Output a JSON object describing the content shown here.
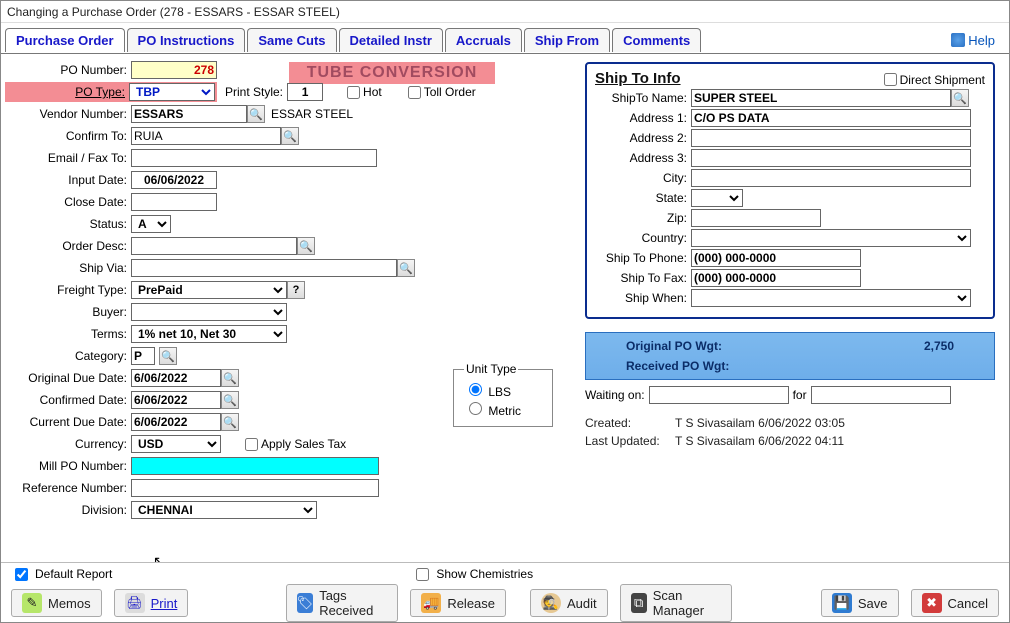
{
  "window": {
    "title": "Changing a Purchase Order  (278 - ESSARS -  ESSAR STEEL)"
  },
  "tabs": {
    "po": "Purchase Order",
    "instr": "PO Instructions",
    "same": "Same Cuts",
    "det": "Detailed Instr",
    "accr": "Accruals",
    "ship": "Ship From",
    "comm": "Comments"
  },
  "help": "Help",
  "watermark": "TUBE CONVERSION",
  "labels": {
    "po_number": "PO Number:",
    "po_type": "PO Type:",
    "print_style": "Print Style:",
    "hot": "Hot",
    "toll": "Toll Order",
    "vendor_number": "Vendor Number:",
    "confirm_to": "Confirm To:",
    "email_fax": "Email / Fax To:",
    "input_date": "Input Date:",
    "close_date": "Close Date:",
    "status": "Status:",
    "order_desc": "Order Desc:",
    "ship_via": "Ship Via:",
    "freight_type": "Freight Type:",
    "buyer": "Buyer:",
    "terms": "Terms:",
    "category": "Category:",
    "orig_due": "Original Due Date:",
    "conf_date": "Confirmed Date:",
    "curr_due": "Current Due Date:",
    "currency": "Currency:",
    "apply_tax": "Apply Sales Tax",
    "mill_po": "Mill PO Number:",
    "ref_no": "Reference Number:",
    "division": "Division:",
    "unit_type": "Unit Type",
    "lbs": "LBS",
    "metric": "Metric"
  },
  "values": {
    "po_number": "278",
    "po_type": "TBP",
    "print_style": "1",
    "vendor_number": "ESSARS",
    "vendor_name": "ESSAR STEEL",
    "confirm_to": "RUIA",
    "email_fax": "",
    "input_date": "06/06/2022",
    "close_date": "",
    "status": "A",
    "order_desc": "",
    "ship_via": "",
    "freight_type": "PrePaid",
    "buyer": "",
    "terms": "1% net 10, Net 30",
    "category": "P",
    "orig_due": "6/06/2022",
    "conf_date": "6/06/2022",
    "curr_due": "6/06/2022",
    "currency": "USD",
    "mill_po": "",
    "ref_no": "",
    "division": "CHENNAI"
  },
  "shipto": {
    "heading": "Ship To Info",
    "direct": "Direct Shipment",
    "name_lbl": "ShipTo Name:",
    "addr1_lbl": "Address 1:",
    "addr2_lbl": "Address 2:",
    "addr3_lbl": "Address 3:",
    "city_lbl": "City:",
    "state_lbl": "State:",
    "zip_lbl": "Zip:",
    "country_lbl": "Country:",
    "phone_lbl": "Ship To Phone:",
    "fax_lbl": "Ship To Fax:",
    "when_lbl": "Ship When:",
    "name": "SUPER STEEL",
    "addr1": "C/O PS DATA",
    "addr2": "",
    "addr3": "",
    "city": "",
    "state": "",
    "zip": "",
    "country": "",
    "phone": "(000) 000-0000",
    "fax": "(000) 000-0000",
    "when": ""
  },
  "wgt": {
    "orig_lbl": "Original PO Wgt:",
    "orig_val": "2,750",
    "recv_lbl": "Received PO Wgt:",
    "recv_val": ""
  },
  "waiting": {
    "label": "Waiting on:",
    "for": "for"
  },
  "meta": {
    "created_lbl": "Created:",
    "created_val": "T S Sivasailam 6/06/2022 03:05",
    "updated_lbl": "Last Updated:",
    "updated_val": "T S Sivasailam 6/06/2022 04:11"
  },
  "footer": {
    "default_report": "Default Report",
    "show_chem": "Show Chemistries",
    "memos": "Memos",
    "print": "Print",
    "tags": "Tags Received",
    "release": "Release",
    "audit": "Audit",
    "scan": "Scan Manager",
    "save": "Save",
    "cancel": "Cancel"
  }
}
